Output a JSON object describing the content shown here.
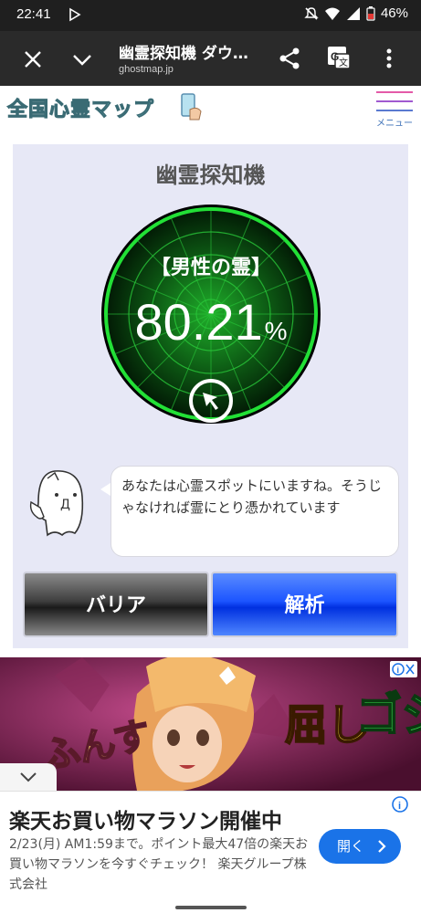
{
  "status_bar": {
    "time": "22:41",
    "battery": "46%"
  },
  "toolbar": {
    "title": "幽霊探知機 ダウ…",
    "url": "ghostmap.jp"
  },
  "site_header": {
    "logo_text": "全国心霊マップ",
    "menu_label": "メニュー"
  },
  "detector": {
    "title": "幽霊探知機",
    "ghost_type": "【男性の霊】",
    "value": "80.21",
    "unit": "%"
  },
  "message": {
    "text": "あなたは心霊スポットにいますね。そうじゃなければ霊にとり憑かれています",
    "ghost_face": "Д"
  },
  "buttons": {
    "barrier": "バリア",
    "analyze": "解析"
  },
  "ad_banner": {
    "left_text": "ふんす",
    "right_text": "屈し",
    "right_text2": "ゴジ"
  },
  "ad_card": {
    "title": "楽天お買い物マラソン開催中",
    "body": "2/23(月) AM1:59まで。ポイント最大47倍の楽天お買い物マラソンを今すぐチェック！ 楽天グループ株式会社",
    "open_button": "開く"
  },
  "colors": {
    "radar_green": "#1cd12c",
    "panel_bg": "#e7e8f6",
    "analyze_blue": "#1c54ff",
    "toolbar_bg": "#2a2a2a"
  }
}
